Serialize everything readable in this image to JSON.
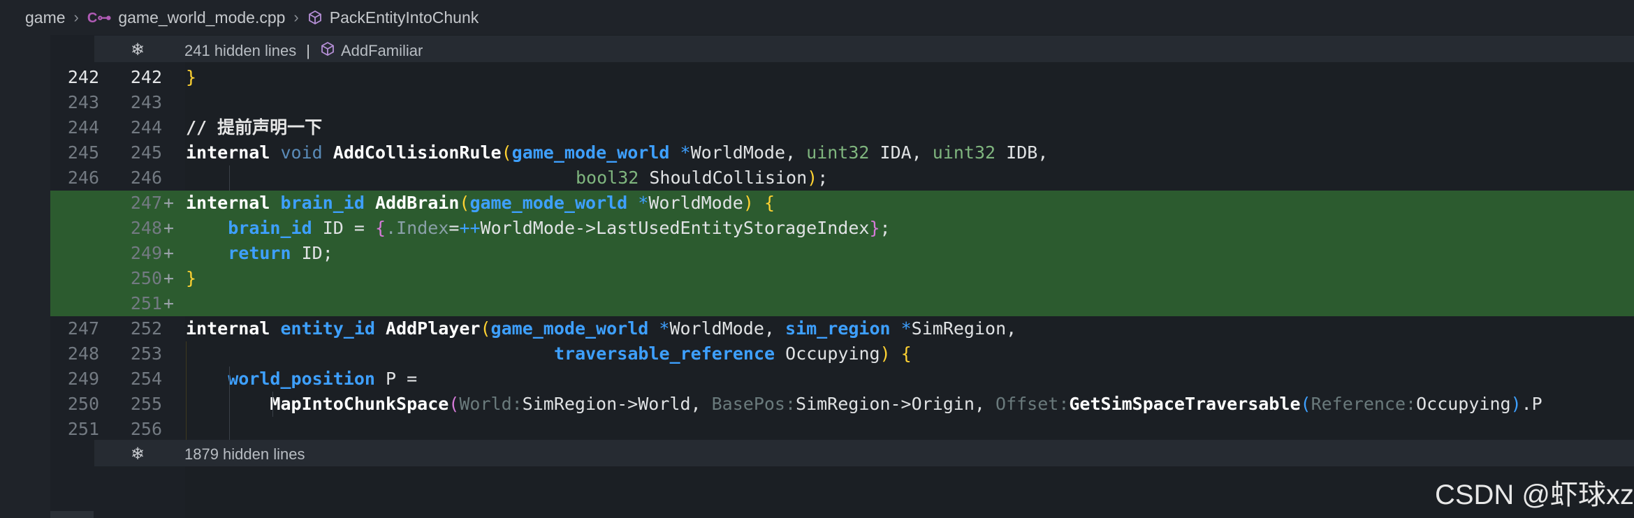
{
  "breadcrumb": {
    "item1": "game",
    "item2": "game_world_mode.cpp",
    "item3": "PackEntityIntoChunk",
    "cpp_icon_glyph": "C⊶",
    "icons": [
      "chevron-right-icon",
      "cpp-file-icon",
      "cube-symbol-icon"
    ]
  },
  "fold_top": {
    "text": "241 hidden lines",
    "separator": "|",
    "symbol": "AddFamiliar"
  },
  "fold_bottom": {
    "text": "1879 hidden lines"
  },
  "lines": {
    "l1": {
      "old": "242",
      "new": "242",
      "plus": ""
    },
    "l2": {
      "old": "243",
      "new": "243",
      "plus": ""
    },
    "l3": {
      "old": "244",
      "new": "244",
      "plus": ""
    },
    "l4": {
      "old": "245",
      "new": "245",
      "plus": ""
    },
    "l5": {
      "old": "246",
      "new": "246",
      "plus": ""
    },
    "l6": {
      "old": "",
      "new": "247",
      "plus": "+"
    },
    "l7": {
      "old": "",
      "new": "248",
      "plus": "+"
    },
    "l8": {
      "old": "",
      "new": "249",
      "plus": "+"
    },
    "l9": {
      "old": "",
      "new": "250",
      "plus": "+"
    },
    "l10": {
      "old": "",
      "new": "251",
      "plus": "+"
    },
    "l11": {
      "old": "247",
      "new": "252",
      "plus": ""
    },
    "l12": {
      "old": "248",
      "new": "253",
      "plus": ""
    },
    "l13": {
      "old": "249",
      "new": "254",
      "plus": ""
    },
    "l14": {
      "old": "250",
      "new": "255",
      "plus": ""
    },
    "l15": {
      "old": "251",
      "new": "256",
      "plus": ""
    }
  },
  "code": {
    "comment": "// 提前声明一下",
    "internal": "internal",
    "void": "void",
    "add_collision_rule": "AddCollisionRule",
    "game_mode_world": "game_mode_world",
    "world_mode": "WorldMode",
    "uint32": "uint32",
    "ida": "IDA",
    "idb": "IDB",
    "bool32": "bool32",
    "should_collision": "ShouldCollision",
    "brain_id": "brain_id",
    "add_brain": "AddBrain",
    "id_var": "ID",
    "index_field": ".Index",
    "inc": "++",
    "last_used": "WorldMode->LastUsedEntityStorageIndex",
    "return_kw": "return",
    "entity_id": "entity_id",
    "add_player": "AddPlayer",
    "sim_region_type": "sim_region",
    "sim_region": "SimRegion",
    "traversable_reference": "traversable_reference",
    "occupying": "Occupying",
    "world_position": "world_position",
    "p_var": "P",
    "map_into": "MapIntoChunkSpace",
    "hint_world": "World:",
    "sr_world": "SimRegion->World",
    "hint_basepos": "BasePos:",
    "sr_origin": "SimRegion->Origin",
    "hint_offset": "Offset:",
    "get_sim": "GetSimSpaceTraversable",
    "hint_reference": "Reference:",
    "tail_p": ".P"
  },
  "watermark": "CSDN @虾球xz",
  "colors": {
    "added_bg": "#2c5b2f",
    "keyword_blue": "#3ea0ff",
    "paren_yellow": "#ffd232",
    "brace_magenta": "#d67ad8"
  }
}
